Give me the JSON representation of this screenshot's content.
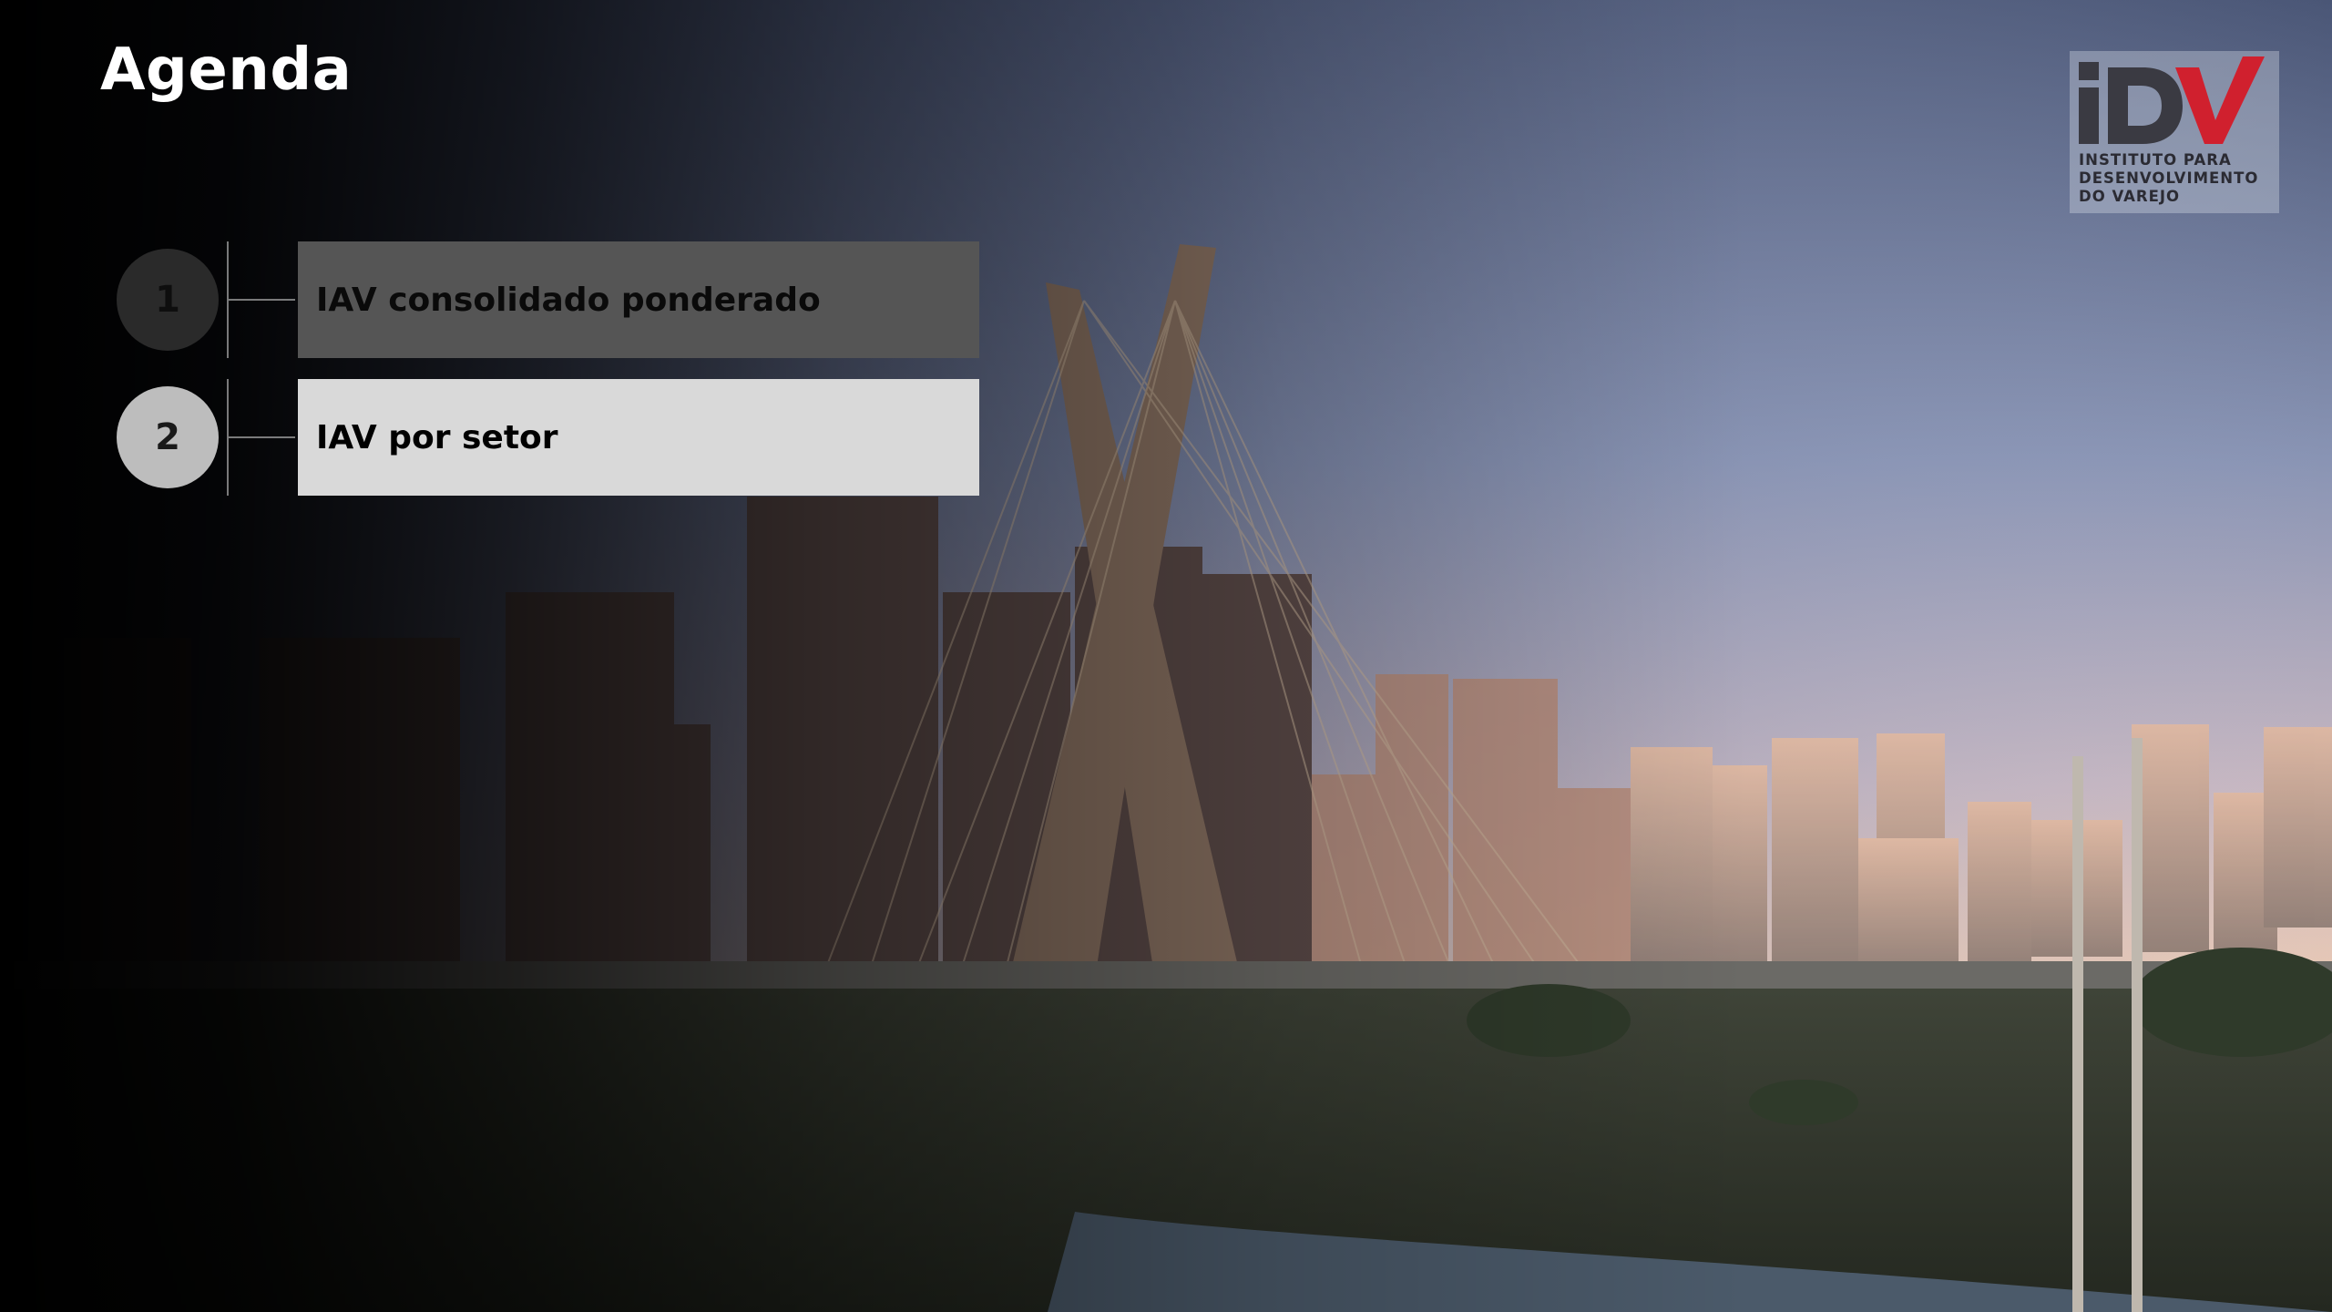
{
  "slide": {
    "title": "Agenda"
  },
  "agenda": {
    "items": [
      {
        "number": "1",
        "label": "IAV consolidado ponderado"
      },
      {
        "number": "2",
        "label": "IAV por setor"
      }
    ]
  },
  "logo": {
    "brand": "iDV",
    "line1": "INSTITUTO PARA",
    "line2": "DESENVOLVIMENTO",
    "line3": "DO VAREJO",
    "accent_color": "#d0202e"
  },
  "background": {
    "description_icon": "city-skyline-bridge-image"
  }
}
